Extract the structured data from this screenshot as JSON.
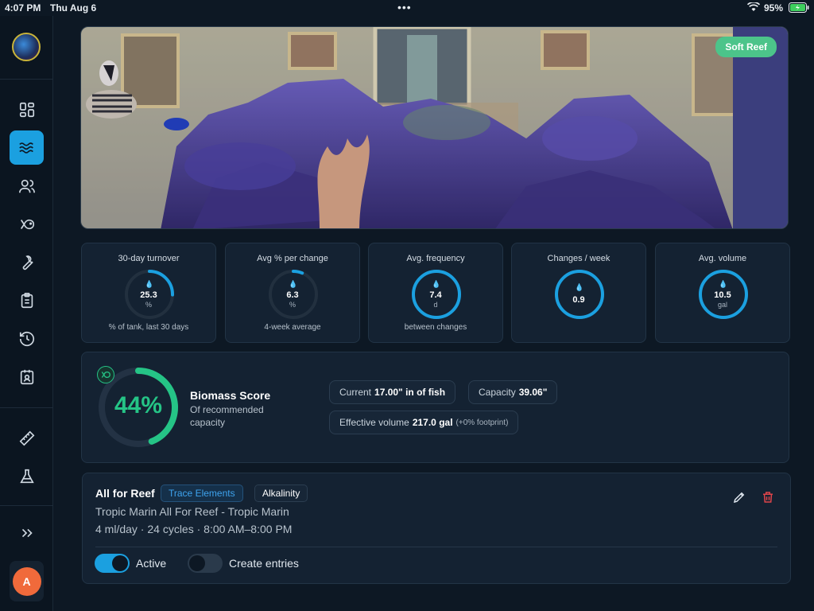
{
  "status_bar": {
    "time": "4:07 PM",
    "date": "Thu Aug 6",
    "battery": "95%"
  },
  "sidebar": {
    "items": [
      {
        "name": "dashboard",
        "icon": "grid-icon"
      },
      {
        "name": "water",
        "icon": "waves-icon",
        "active": true
      },
      {
        "name": "livestock",
        "icon": "users-icon"
      },
      {
        "name": "fish",
        "icon": "fish-icon"
      },
      {
        "name": "maintenance",
        "icon": "wrench-icon"
      },
      {
        "name": "tasks",
        "icon": "clipboard-icon"
      },
      {
        "name": "history",
        "icon": "history-icon"
      },
      {
        "name": "reports",
        "icon": "badge-icon"
      },
      {
        "name": "measure",
        "icon": "ruler-icon"
      },
      {
        "name": "tests",
        "icon": "flask-icon"
      }
    ],
    "expand_icon": "chevrons-right-icon",
    "user_initial": "A"
  },
  "hero": {
    "badge": "Soft Reef"
  },
  "stats": [
    {
      "label": "30-day turnover",
      "value": "25.3",
      "unit": "%",
      "sub": "% of tank, last 30 days",
      "fill": 0.253
    },
    {
      "label": "Avg % per change",
      "value": "6.3",
      "unit": "%",
      "sub": "4-week average",
      "fill": 0.063
    },
    {
      "label": "Avg. frequency",
      "value": "7.4",
      "unit": "d",
      "sub": "between changes",
      "fill": 1.0
    },
    {
      "label": "Changes / week",
      "value": "0.9",
      "unit": "",
      "sub": "",
      "fill": 1.0
    },
    {
      "label": "Avg. volume",
      "value": "10.5",
      "unit": "gal",
      "sub": "",
      "fill": 1.0
    }
  ],
  "biomass": {
    "percent": "44%",
    "fill": 0.44,
    "title": "Biomass Score",
    "desc": "Of recommended capacity",
    "current_label": "Current",
    "current_value": "17.00\" in of fish",
    "capacity_label": "Capacity",
    "capacity_value": "39.06\"",
    "effective_label": "Effective volume",
    "effective_value": "217.0 gal",
    "effective_note": "(+0% footprint)"
  },
  "dosing": {
    "name": "All for Reef",
    "tag_primary": "Trace Elements",
    "tag_secondary": "Alkalinity",
    "product": "Tropic Marin All For Reef - Tropic Marin",
    "schedule": "4 ml/day · 24 cycles · 8:00 AM–8:00 PM",
    "active_label": "Active",
    "active_on": true,
    "entries_label": "Create entries",
    "entries_on": false
  },
  "colors": {
    "accent": "#1ba0e0",
    "success": "#25c486",
    "danger": "#e0444a",
    "badge": "#4cc48a"
  }
}
